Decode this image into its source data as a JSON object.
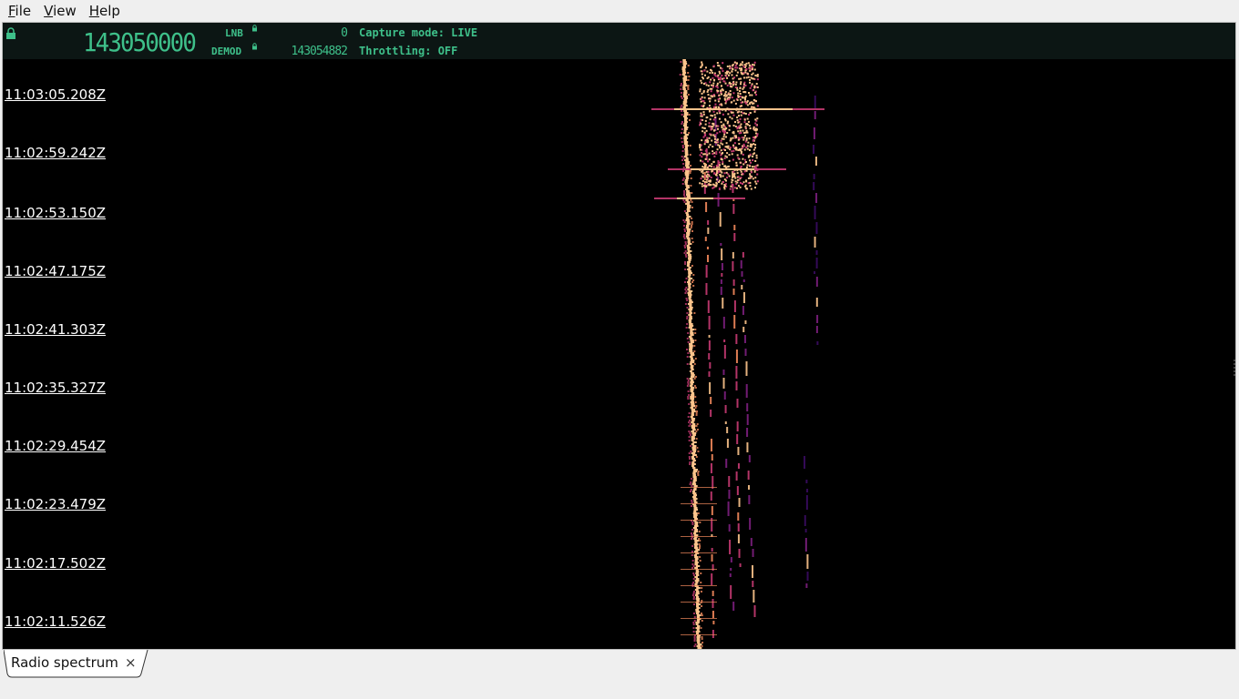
{
  "menu": {
    "items": [
      {
        "label_u": "F",
        "label_rest": "ile"
      },
      {
        "label_u": "V",
        "label_rest": "iew"
      },
      {
        "label_u": "H",
        "label_rest": "elp"
      }
    ]
  },
  "header": {
    "frequency": "143050000",
    "lnb_label": "LNB",
    "demod_label": "DEMOD",
    "lnb_value": "0",
    "demod_value": "143054882",
    "capture_mode": "Capture mode: LIVE",
    "throttling": "Throttling: OFF",
    "accent_color": "#3ec08a"
  },
  "waterfall": {
    "timestamps": [
      "11:03:05.208Z",
      "11:02:59.242Z",
      "11:02:53.150Z",
      "11:02:47.175Z",
      "11:02:41.303Z",
      "11:02:35.327Z",
      "11:02:29.454Z",
      "11:02:23.479Z",
      "11:02:17.502Z",
      "11:02:11.526Z"
    ],
    "palette": [
      "#000000",
      "#3a0b62",
      "#7d1f80",
      "#c73a72",
      "#f48a5c",
      "#fcc48c"
    ]
  },
  "tabs": [
    {
      "label": "Radio spectrum",
      "close": "×"
    }
  ]
}
